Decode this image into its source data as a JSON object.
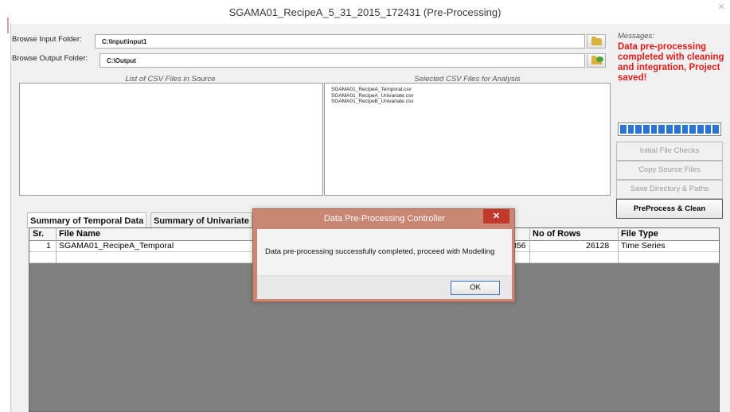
{
  "window": {
    "title": "SGAMA01_RecipeA_5_31_2015_172431 (Pre-Processing)",
    "close_glyph": "✕"
  },
  "input_folder": {
    "label": "Browse Input Folder:",
    "value": "C:\\Input\\input1"
  },
  "output_folder": {
    "label": "Browse Output Folder:",
    "value": "C:\\Output"
  },
  "source_list": {
    "header": "List of CSV Files in Source",
    "items": []
  },
  "selected_list": {
    "header": "Selected CSV Files for Analysis",
    "items": [
      "SGAMA01_RecipeA_Temporal.csv",
      "SGAMA01_RecipeA_Univariate.csv",
      "SGAMA01_RecipeB_Univariate.csv"
    ]
  },
  "messages": {
    "header": "Messages:",
    "text": "Data pre-processing completed with cleaning and integration, Project saved!",
    "accent_color": "#e21a1a"
  },
  "progress": {
    "value": 1.0,
    "color": "#2a72d4"
  },
  "buttons": {
    "initial_file_checks": "Initial File Checks",
    "copy_source_files": "Copy Source Files",
    "save_directory_paths": "Save Directory & Paths",
    "preprocess_clean": "PreProcess & Clean"
  },
  "tabs": {
    "temporal": "Summary of Temporal Data",
    "univariate": "Summary of Univariate"
  },
  "grid": {
    "columns": {
      "sr": "Sr.",
      "file_name": "File Name",
      "no_of_rows": "No of Rows",
      "file_type": "File Type"
    },
    "rows": [
      {
        "sr": "1",
        "file_name": "SGAMA01_RecipeA_Temporal",
        "partial": "356",
        "no_of_rows": "26128",
        "file_type": "Time Series"
      }
    ]
  },
  "dialog": {
    "title": "Data Pre-Processing Controller",
    "message": "Data pre-processing successfully completed, proceed with Modelling",
    "ok_label": "OK",
    "close_glyph": "✕"
  }
}
